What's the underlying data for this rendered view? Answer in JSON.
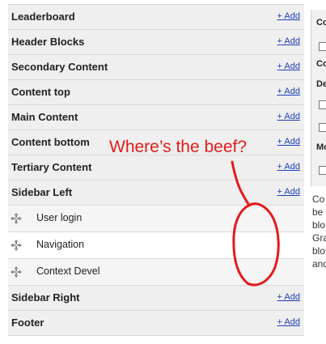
{
  "regions_top": [
    {
      "title": "Leaderboard",
      "add": "+ Add"
    },
    {
      "title": "Header Blocks",
      "add": "+ Add"
    },
    {
      "title": "Secondary Content",
      "add": "+ Add"
    },
    {
      "title": "Content top",
      "add": "+ Add"
    },
    {
      "title": "Main Content",
      "add": "+ Add"
    },
    {
      "title": "Content bottom",
      "add": "+ Add"
    },
    {
      "title": "Tertiary Content",
      "add": "+ Add"
    },
    {
      "title": "Sidebar Left",
      "add": "+ Add"
    }
  ],
  "sidebar_left_blocks": [
    {
      "label": "User login"
    },
    {
      "label": "Navigation"
    },
    {
      "label": "Context Devel"
    }
  ],
  "regions_bottom": [
    {
      "title": "Sidebar Right",
      "add": "+ Add"
    },
    {
      "title": "Footer",
      "add": "+ Add"
    }
  ],
  "side_panel": {
    "row1": "Co",
    "row2": "Co",
    "row3": "De",
    "row4": "Mo",
    "text_lines": [
      "Co",
      "be",
      "blo",
      "Gra",
      "blo",
      "and"
    ]
  },
  "annotation": {
    "text": "Where’s the beef?",
    "color": "#e31b1b"
  },
  "colors": {
    "link": "#1a3fb8",
    "region_bg": "#efefef"
  },
  "icons": {
    "drag_handle": "move-arrows-icon"
  }
}
